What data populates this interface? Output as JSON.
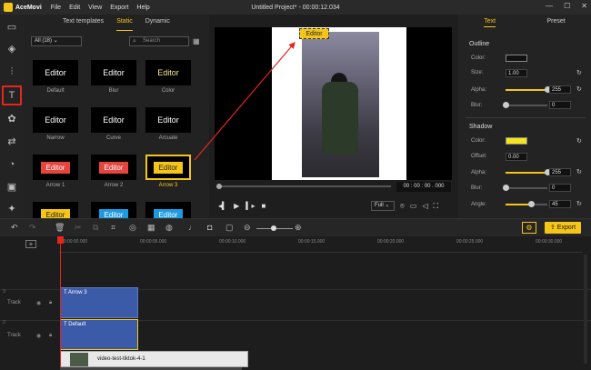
{
  "app": {
    "name": "AceMovi",
    "window_title": "Untitled Project* - 00:00:12.034",
    "menu": [
      "File",
      "Edit",
      "View",
      "Export",
      "Help"
    ]
  },
  "window_controls": [
    "—",
    "☐",
    "✕"
  ],
  "leftbar": {
    "icons": [
      "folder-icon",
      "layers-icon",
      "audio-icon",
      "text-icon",
      "effects-icon",
      "transition-icon",
      "sticker-icon",
      "crop-icon",
      "sparkle-icon"
    ]
  },
  "library": {
    "tabs": [
      "Text templates",
      "Static",
      "Dynamic"
    ],
    "active_tab": "Static",
    "filter": "All (18)  ⌄",
    "search_placeholder": "Search",
    "tiles": [
      {
        "text": "Editor",
        "label": "Default",
        "color": "#ffffff",
        "bg": "#000000"
      },
      {
        "text": "Editor",
        "label": "Blur",
        "color": "#ffffff",
        "bg": "#000000"
      },
      {
        "text": "Editor",
        "label": "Color",
        "color": "#f3e98a",
        "bg": "#000000"
      },
      {
        "text": "Editor",
        "label": "Narrow",
        "color": "#ffffff",
        "bg": "#000000"
      },
      {
        "text": "Editor",
        "label": "Curve",
        "color": "#ffffff",
        "bg": "#000000"
      },
      {
        "text": "Editor",
        "label": "Arcuate",
        "color": "#ffffff",
        "bg": "#000000"
      },
      {
        "text": "Editor",
        "label": "Arrow 1",
        "color": "#ffffff",
        "bg": "#e5443f"
      },
      {
        "text": "Editor",
        "label": "Arrow 2",
        "color": "#ffffff",
        "bg": "#e5443f"
      },
      {
        "text": "Editor",
        "label": "Arrow 3",
        "color": "#222222",
        "bg": "#f5c518"
      },
      {
        "text": "Editor",
        "label": "",
        "color": "#222222",
        "bg": "#f5c518"
      },
      {
        "text": "Editor",
        "label": "",
        "color": "#ffffff",
        "bg": "#1e9be0"
      },
      {
        "text": "Editor",
        "label": "",
        "color": "#ffffff",
        "bg": "#1e9be0"
      }
    ]
  },
  "preview": {
    "caption": "Editor",
    "timecode": "00 : 00 : 00 . 000",
    "quality": "Full ⌄"
  },
  "props": {
    "tabs": [
      "Text",
      "Preset"
    ],
    "active_tab": "Text",
    "outline": {
      "title": "Outline",
      "color_label": "Color:",
      "color": "#111111",
      "size_label": "Size:",
      "size": "1.00",
      "alpha_label": "Alpha:",
      "alpha": "255",
      "alpha_frac": 1.0,
      "blur_label": "Blur:",
      "blur": "0",
      "blur_frac": 0.0
    },
    "shadow": {
      "title": "Shadow",
      "color_label": "Color:",
      "color": "#f5e51a",
      "offset_label": "Offset:",
      "offset": "0.00",
      "alpha_label": "Alpha:",
      "alpha": "255",
      "alpha_frac": 1.0,
      "blur_label": "Blur:",
      "blur": "0",
      "blur_frac": 0.0,
      "angle_label": "Angle:",
      "angle": "45",
      "angle_frac": 0.6
    }
  },
  "toolbar": {
    "export_label": "Export"
  },
  "timeline": {
    "ticks": [
      "00:00:00.000",
      "00:00:05.000",
      "00:00:10.000",
      "00:00:15.000",
      "00:00:20.000",
      "00:00:25.000",
      "00:00:30.000"
    ],
    "tracks": [
      {
        "num": "3",
        "label": "Track",
        "clip": "Arrow 3"
      },
      {
        "num": "2",
        "label": "Track",
        "clip": "Default"
      }
    ],
    "video_clip": "video-test-tiktok-4-1"
  },
  "accent": "#f5c518",
  "highlight": "#e5251e"
}
